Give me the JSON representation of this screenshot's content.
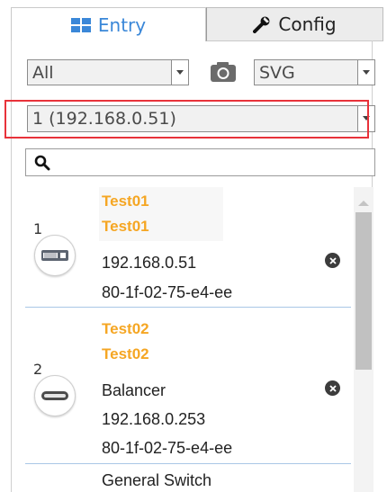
{
  "tabs": {
    "entry_label": "Entry",
    "config_label": "Config"
  },
  "filters": {
    "type_select_value": "All",
    "format_select_value": "SVG",
    "host_select_value": "1 (192.168.0.51)"
  },
  "search": {
    "placeholder": ""
  },
  "devices": [
    {
      "number": "1",
      "name_line1": "Test01",
      "name_line2": "Test01",
      "ip": "192.168.0.51",
      "mac": "80-1f-02-75-e4-ee"
    },
    {
      "number": "2",
      "name_line1": "Test02",
      "name_line2": "Test02",
      "type": "Balancer",
      "ip": "192.168.0.253",
      "mac": "80-1f-02-75-e4-ee"
    }
  ],
  "partial_row": {
    "type": "General Switch"
  },
  "colors": {
    "accent": "#3a87d8",
    "device_name": "#f5a623",
    "highlight_box": "#e8323a"
  }
}
